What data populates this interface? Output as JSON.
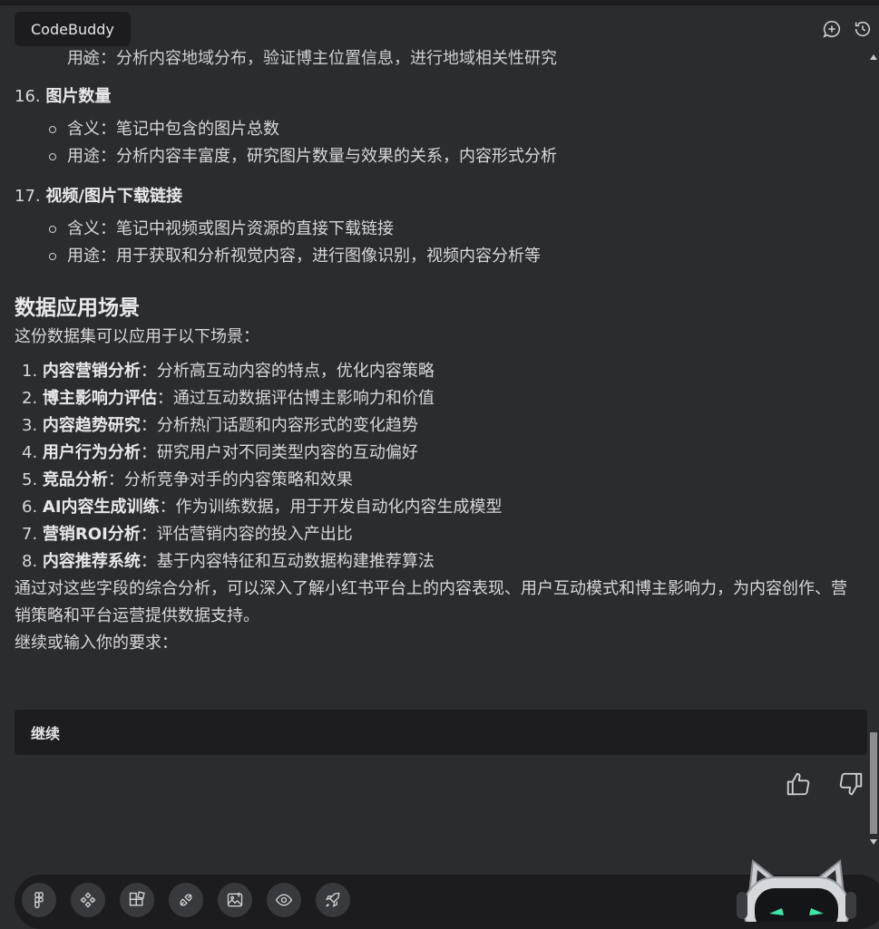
{
  "header": {
    "title": "CodeBuddy",
    "icons": [
      "add-chat-icon",
      "history-icon"
    ]
  },
  "content": {
    "cut_off_line": "用途：分析内容地域分布，验证博主位置信息，进行地域相关性研究",
    "items": [
      {
        "number": "16.",
        "title": "图片数量",
        "bullets": [
          "含义：笔记中包含的图片总数",
          "用途：分析内容丰富度，研究图片数量与效果的关系，内容形式分析"
        ]
      },
      {
        "number": "17.",
        "title": "视频/图片下载链接",
        "bullets": [
          "含义：笔记中视频或图片资源的直接下载链接",
          "用途：用于获取和分析视觉内容，进行图像识别，视频内容分析等"
        ]
      }
    ],
    "section_title": "数据应用场景",
    "intro": "这份数据集可以应用于以下场景：",
    "scenarios": [
      {
        "number": "1.",
        "title": "内容营销分析",
        "desc": "：分析高互动内容的特点，优化内容策略"
      },
      {
        "number": "2.",
        "title": "博主影响力评估",
        "desc": "：通过互动数据评估博主影响力和价值"
      },
      {
        "number": "3.",
        "title": "内容趋势研究",
        "desc": "：分析热门话题和内容形式的变化趋势"
      },
      {
        "number": "4.",
        "title": "用户行为分析",
        "desc": "：研究用户对不同类型内容的互动偏好"
      },
      {
        "number": "5.",
        "title": "竞品分析",
        "desc": "：分析竞争对手的内容策略和效果"
      },
      {
        "number": "6.",
        "title": "AI内容生成训练",
        "desc": "：作为训练数据，用于开发自动化内容生成模型"
      },
      {
        "number": "7.",
        "title": "营销ROI分析",
        "desc": "：评估营销内容的投入产出比"
      },
      {
        "number": "8.",
        "title": "内容推荐系统",
        "desc": "：基于内容特征和互动数据构建推荐算法"
      }
    ],
    "summary": "通过对这些字段的综合分析，可以深入了解小红书平台上的内容表现、用户互动模式和博主影响力，为内容创作、营销策略和平台运营提供数据支持。",
    "prompt": "继续或输入你的要求："
  },
  "reply": {
    "value": "继续"
  },
  "feedback": {
    "icons": [
      "thumbs-up-icon",
      "thumbs-down-icon"
    ]
  },
  "toolbar": {
    "tools": [
      "figma-icon",
      "components-icon",
      "blocks-icon",
      "plugin-icon",
      "image-upload-icon",
      "preview-icon",
      "deploy-icon"
    ]
  }
}
